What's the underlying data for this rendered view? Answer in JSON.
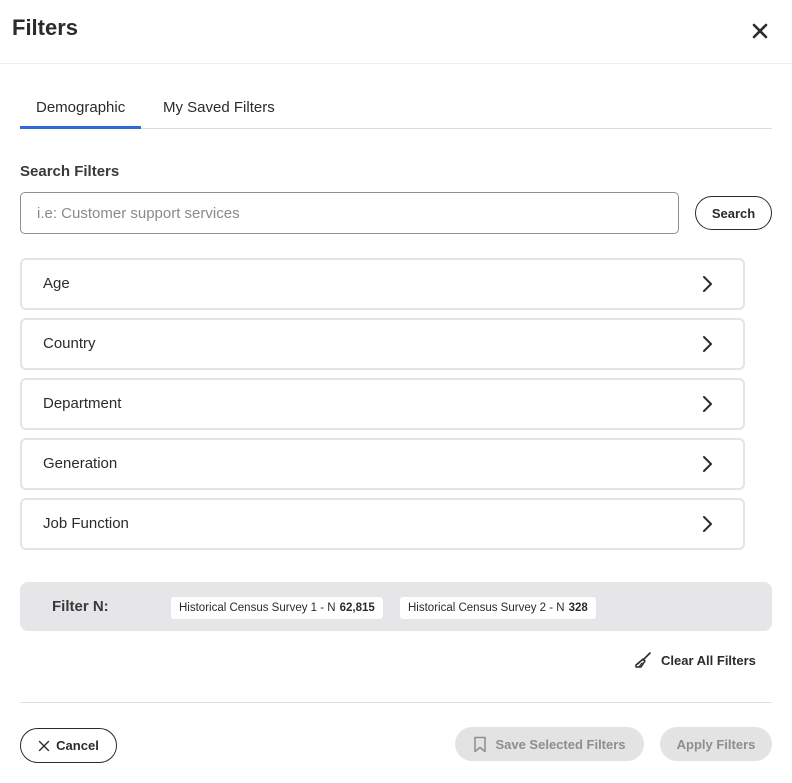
{
  "header": {
    "title": "Filters",
    "close_icon": "close-icon"
  },
  "tabs": [
    {
      "label": "Demographic",
      "active": true
    },
    {
      "label": "My Saved Filters",
      "active": false
    }
  ],
  "search": {
    "label": "Search Filters",
    "placeholder": "i.e: Customer support services",
    "value": "",
    "button_label": "Search"
  },
  "filters": [
    {
      "label": "Age"
    },
    {
      "label": "Country"
    },
    {
      "label": "Department"
    },
    {
      "label": "Generation"
    },
    {
      "label": "Job Function"
    }
  ],
  "filter_n": {
    "label": "Filter N:",
    "chips": [
      {
        "name": "Historical Census Survey 1 - N",
        "count": "62,815"
      },
      {
        "name": "Historical Census Survey 2 - N",
        "count": "328"
      }
    ]
  },
  "clear_all": {
    "label": "Clear All Filters",
    "icon": "broom-icon"
  },
  "footer": {
    "cancel_label": "Cancel",
    "save_label": "Save Selected Filters",
    "save_icon": "bookmark-icon",
    "apply_label": "Apply Filters"
  },
  "colors": {
    "accent": "#2f6bd8",
    "disabled_bg": "#e3e3e3",
    "disabled_text": "#8e8e8e",
    "filter_n_bg": "#e6e6e8"
  }
}
